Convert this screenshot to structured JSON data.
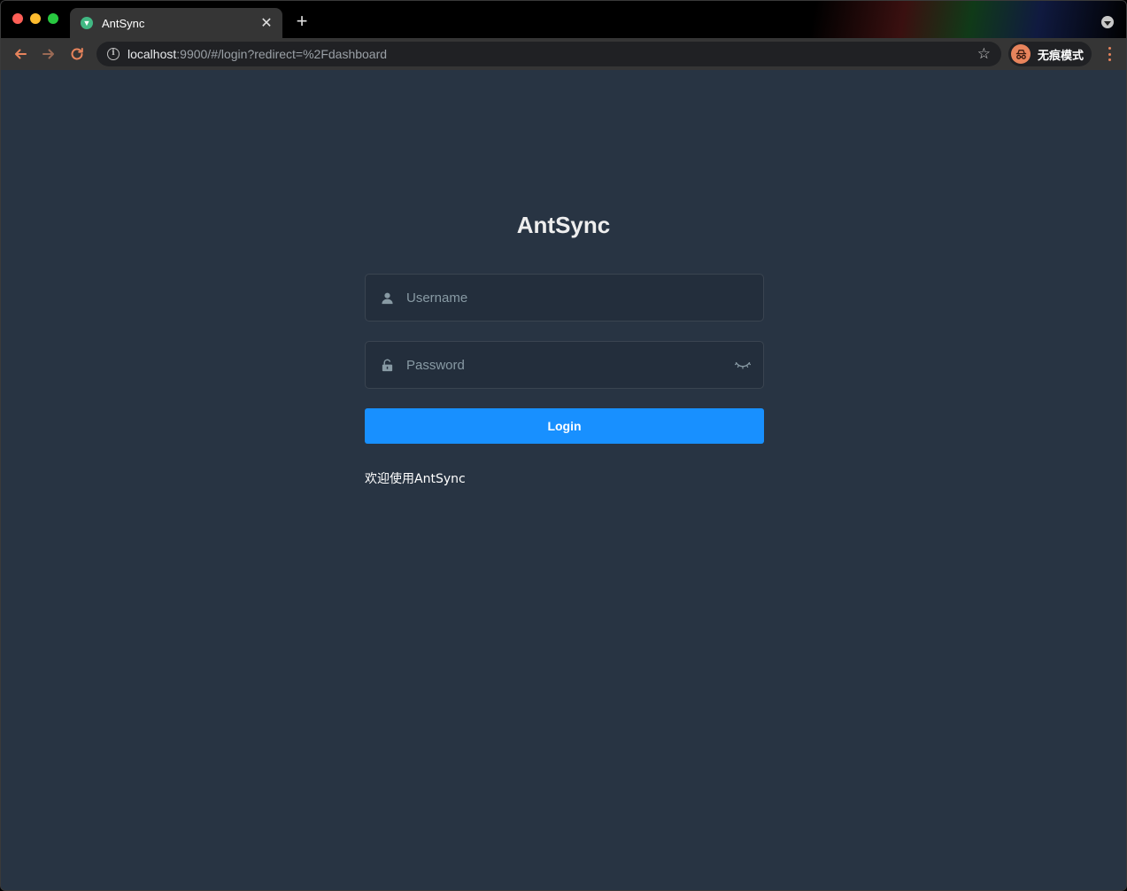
{
  "browser": {
    "tab": {
      "title": "AntSync",
      "favicon": "vue-favicon-icon"
    },
    "url": {
      "host": "localhost",
      "rest": ":9900/#/login?redirect=%2Fdashboard"
    },
    "profile": {
      "label": "无痕模式",
      "icon": "incognito-icon"
    },
    "colors": {
      "accent": "#e8845c",
      "tab_bg": "#353535",
      "omnibox_bg": "#202124"
    }
  },
  "login": {
    "title": "AntSync",
    "username": {
      "placeholder": "Username",
      "value": "",
      "icon": "user-icon"
    },
    "password": {
      "placeholder": "Password",
      "value": "",
      "icon": "lock-icon",
      "toggle_icon": "eye-closed-icon"
    },
    "submit_label": "Login",
    "welcome": "欢迎使用AntSync",
    "colors": {
      "background": "#283443",
      "button": "#1890ff"
    }
  }
}
